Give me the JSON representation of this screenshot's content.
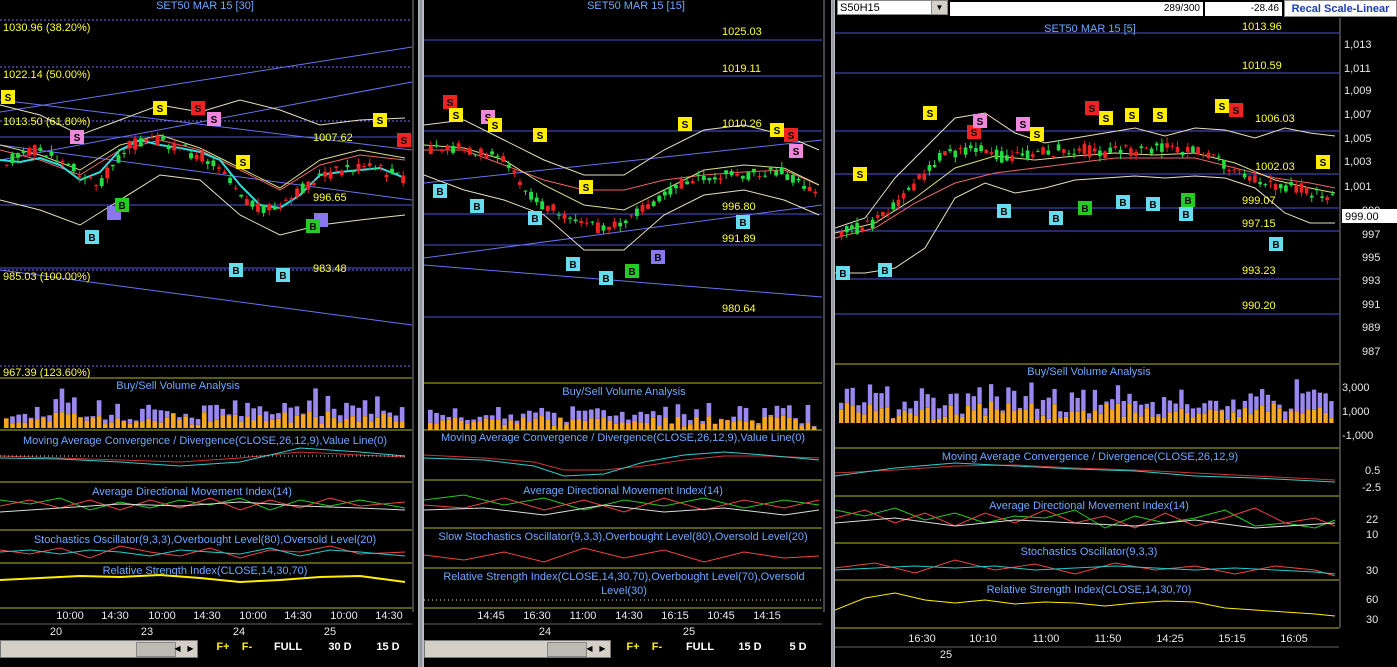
{
  "panels": [
    {
      "title": "SET50 MAR 15  [30]",
      "levels": [
        "1030.96 (38.20%)",
        "1022.14 (50.00%)",
        "1013.50 (61.80%)",
        "1007.62",
        "996.65",
        "985.03 (100.00%)",
        "983.48",
        "967.39 (123.60%)"
      ],
      "buysell": "Buy/Sell Volume Analysis",
      "macd": "Moving Average Convergence / Divergence(CLOSE,26,12,9),Value Line(0)",
      "adx": "Average Directional Movement Index(14)",
      "stoch": "Stochastics Oscillator(9,3,3),Overbought Level(80),Oversold Level(20)",
      "rsi": "Relative Strength Index(CLOSE,14,30,70)",
      "times": [
        "10:00",
        "14:30",
        "10:00",
        "14:30",
        "10:00",
        "14:30",
        "10:00",
        "14:30"
      ],
      "dates": [
        "20",
        "23",
        "24",
        "25"
      ],
      "controls": [
        "F+",
        "F-",
        "FULL",
        "30 D",
        "15 D"
      ]
    },
    {
      "title": "SET50 MAR 15   [15]",
      "levels": [
        "1025.03",
        "1019.11",
        "1010.26",
        "996.80",
        "991.89",
        "980.64"
      ],
      "buysell": "Buy/Sell Volume Analysis",
      "macd": "Moving Average Convergence / Divergence(CLOSE,26,12,9),Value Line(0)",
      "adx": "Average Directional Movement Index(14)",
      "stoch": "Slow Stochastics Oscillator(9,3,3),Overbought Level(80),Oversold Level(20)",
      "rsi": "Relative Strength Index(CLOSE,14,30,70),Overbought Level(70),Oversold Level(30)",
      "times": [
        "14:45",
        "16:30",
        "11:00",
        "14:30",
        "16:15",
        "10:45",
        "14:15"
      ],
      "dates": [
        "24",
        "25"
      ],
      "controls": [
        "F+",
        "F-",
        "FULL",
        "15 D",
        "5 D"
      ]
    },
    {
      "title": "SET50 MAR 15   [5]",
      "symbol": "S50H15",
      "counter": "289/300",
      "change": "-28.46",
      "recal": "Recal Scale-Linear",
      "levels": [
        "1013.96",
        "1010.59",
        "1006.03",
        "1002.03",
        "999.07",
        "997.15",
        "993.23",
        "990.20"
      ],
      "last_price": "999.00",
      "price_axis": [
        "1,013",
        "1,011",
        "1,009",
        "1,007",
        "1,005",
        "1,003",
        "1,001",
        "999",
        "997",
        "995",
        "993",
        "991",
        "989",
        "987"
      ],
      "volume_axis": [
        "3,000",
        "1,000",
        "-1,000"
      ],
      "macd_axis": [
        "0.5",
        "-2.5"
      ],
      "adx_axis": [
        "22",
        "10"
      ],
      "stoch_axis": [
        "30"
      ],
      "rsi_axis": [
        "60",
        "30"
      ],
      "buysell": "Buy/Sell Volume Analysis",
      "macd": "Moving Average Convergence / Divergence(CLOSE,26,12,9)",
      "adx": "Average Directional Movement Index(14)",
      "stoch": "Stochastics Oscillator(9,3,3)",
      "rsi": "Relative Strength Index(CLOSE,14,30,70)",
      "times": [
        "16:30",
        "10:10",
        "11:00",
        "11:50",
        "14:25",
        "15:15",
        "16:05"
      ],
      "dates": [
        "25"
      ]
    }
  ],
  "signals": {
    "buy": "B",
    "sell": "S"
  },
  "colors": {
    "bg": "#000000",
    "title": "#6fa8ff",
    "level_text": "#ffff33",
    "gridline": "#4a55d8",
    "bull": "#22dd44",
    "bear": "#ee2222",
    "volume_buy": "#f5a623",
    "volume_sell": "#9a88f0",
    "sig_yellow": "#ffee00",
    "sig_red": "#ee2222",
    "sig_pink": "#ee88dd",
    "sig_cyan": "#66ddee",
    "sig_green": "#22cc22",
    "sig_purple": "#8877ee"
  }
}
